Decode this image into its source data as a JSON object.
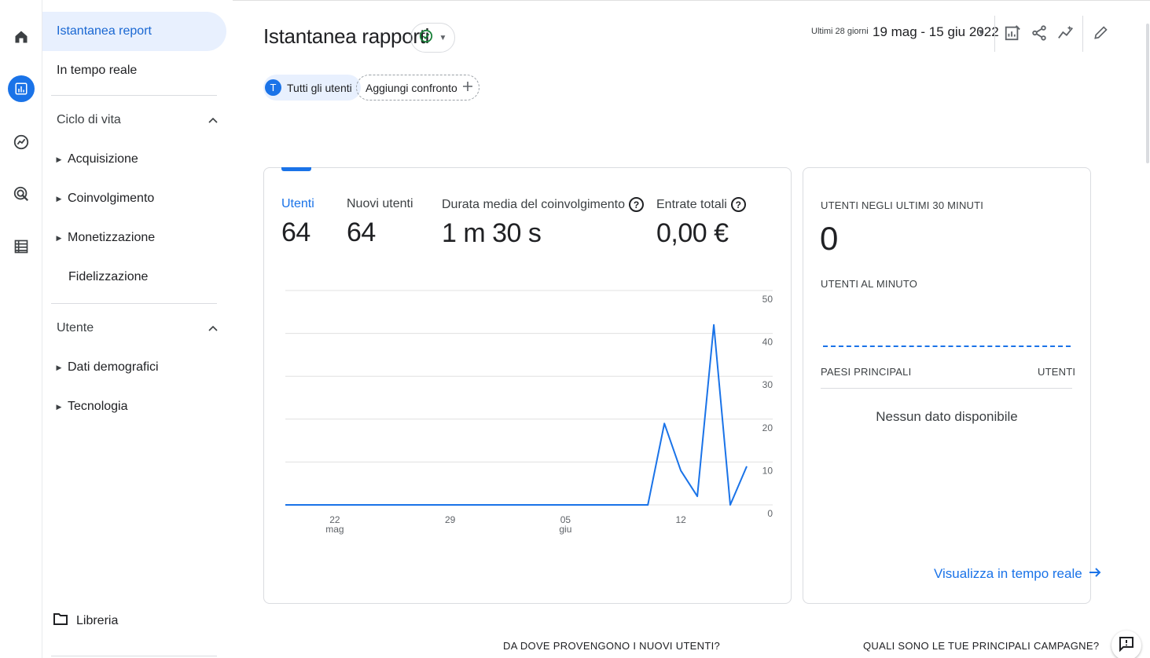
{
  "sidebar": {
    "report_snapshot": "Istantanea report",
    "realtime": "In tempo reale",
    "lifecycle": {
      "title": "Ciclo di vita",
      "items": [
        "Acquisizione",
        "Coinvolgimento",
        "Monetizzazione",
        "Fidelizzazione"
      ]
    },
    "user": {
      "title": "Utente",
      "items": [
        "Dati demografici",
        "Tecnologia"
      ]
    },
    "library": "Libreria"
  },
  "header": {
    "title": "Istantanea rapporti",
    "chip_all_users": "Tutti gli utenti",
    "chip_avatar_letter": "T",
    "chip_add_comparison": "Aggiungi confronto",
    "date_preset": "Ultimi 28 giorni",
    "date_range": "19 mag - 15 giu 2022"
  },
  "metrics": [
    {
      "label": "Utenti",
      "value": "64"
    },
    {
      "label": "Nuovi utenti",
      "value": "64"
    },
    {
      "label": "Durata media del coinvolgimento",
      "value": "1 m 30 s"
    },
    {
      "label": "Entrate totali",
      "value": "0,00 €"
    }
  ],
  "realtime_card": {
    "users_30min_label": "UTENTI NEGLI ULTIMI 30 MINUTI",
    "users_30min_value": "0",
    "users_per_minute_label": "UTENTI AL MINUTO",
    "top_countries_label": "PAESI PRINCIPALI",
    "users_col_label": "UTENTI",
    "no_data": "Nessun dato disponibile",
    "view_realtime": "Visualizza in tempo reale"
  },
  "bottom": {
    "q_new_users": "DA DOVE PROVENGONO I NUOVI UTENTI?",
    "q_campaigns": "QUALI SONO LE TUE PRINCIPALI CAMPAGNE?"
  },
  "colors": {
    "accent": "#1a73e8",
    "active_bg": "#e8f0fe"
  },
  "chart_data": {
    "type": "line",
    "series": [
      {
        "values": [
          0,
          0,
          0,
          0,
          0,
          0,
          0,
          0,
          0,
          0,
          0,
          0,
          0,
          0,
          0,
          0,
          0,
          0,
          0,
          0,
          0,
          0,
          0,
          19,
          8,
          2,
          42,
          0,
          9
        ]
      }
    ],
    "x_tick_labels": [
      {
        "day": "22",
        "month": "mag"
      },
      {
        "day": "29",
        "month": ""
      },
      {
        "day": "05",
        "month": "giu"
      },
      {
        "day": "12",
        "month": ""
      }
    ],
    "y_tick_labels": [
      "50",
      "40",
      "30",
      "20",
      "10",
      "0"
    ],
    "ylim": [
      0,
      50
    ],
    "grid": true,
    "y_axis_side": "right"
  }
}
